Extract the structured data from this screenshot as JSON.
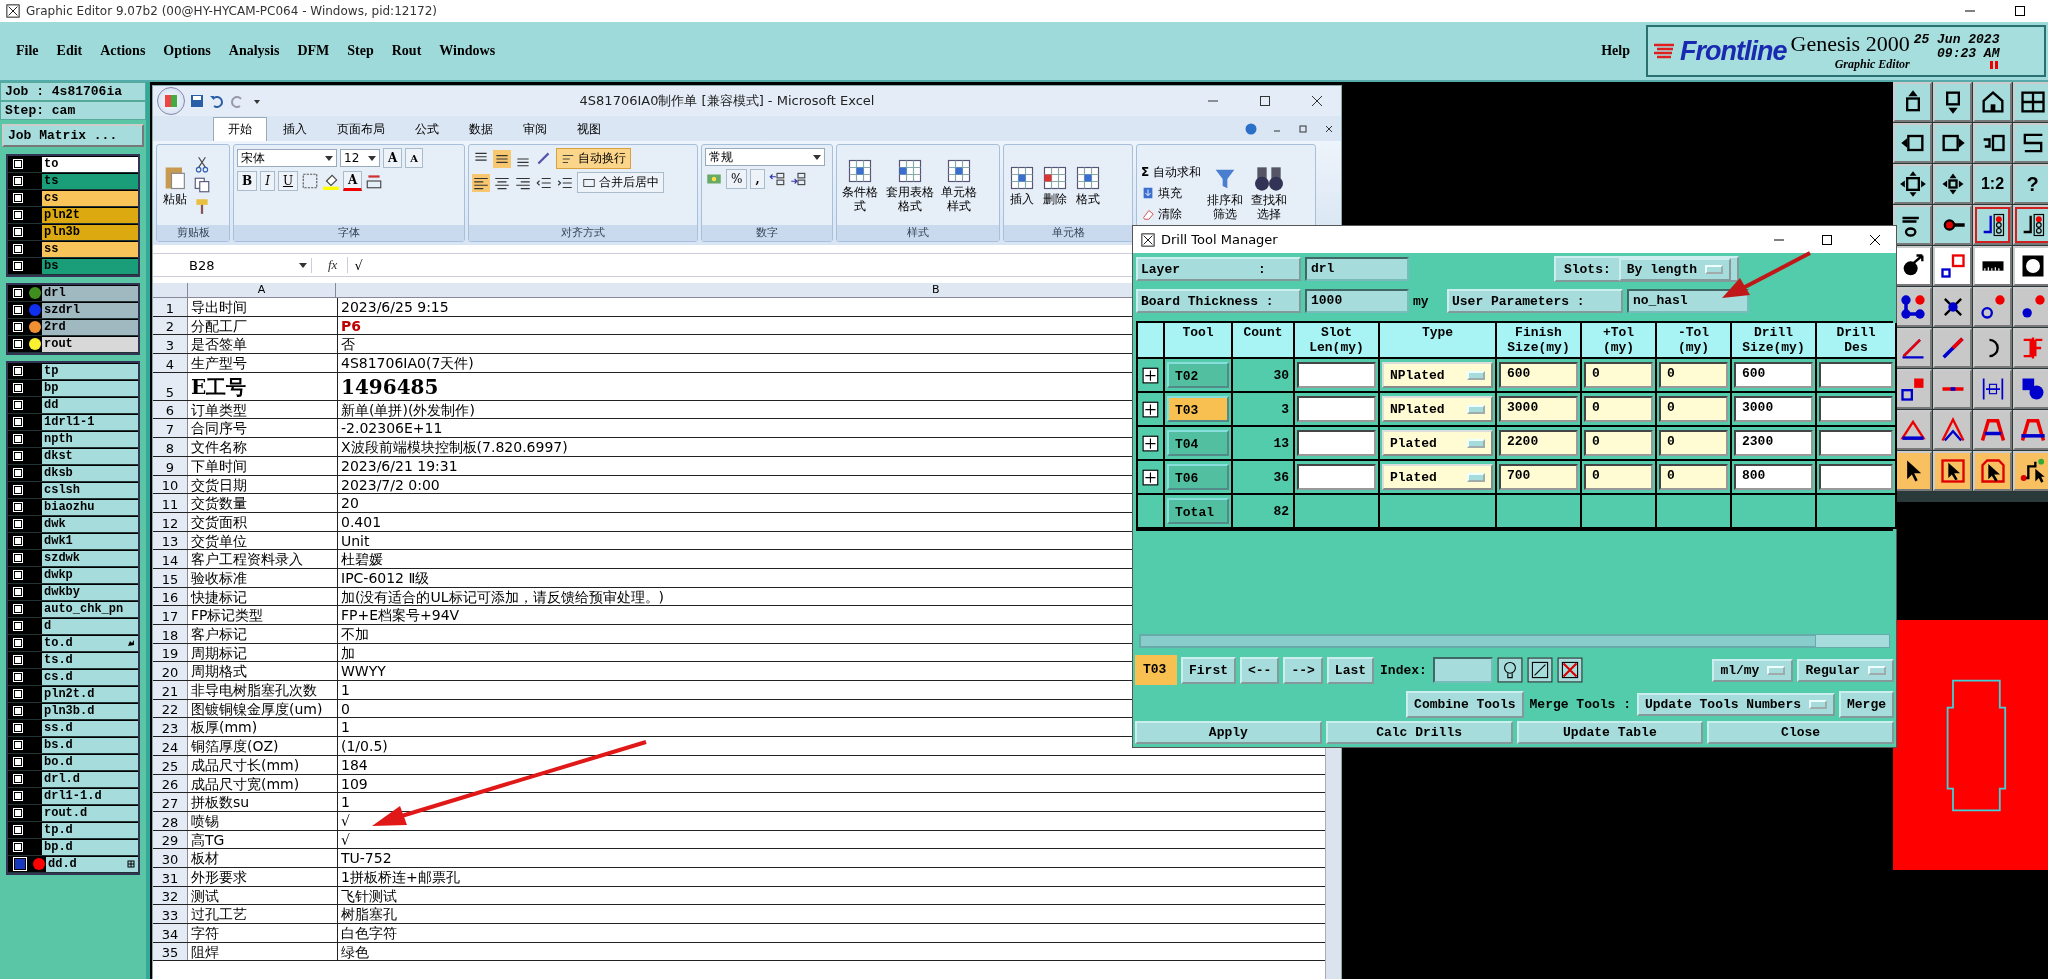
{
  "app_window": {
    "title": "Graphic Editor 9.07b2 (00@HY-HYCAM-PC064 - Windows, pid:12172)"
  },
  "menu": [
    "File",
    "Edit",
    "Actions",
    "Options",
    "Analysis",
    "DFM",
    "Step",
    "Rout",
    "Windows"
  ],
  "help": "Help",
  "brand": {
    "logo": "Frontline",
    "product": "Genesis 2000",
    "subtitle": "Graphic Editor",
    "date": "25 Jun 2023",
    "time": "09:23 AM"
  },
  "job_panel": {
    "job": "Job : 4s81706ia",
    "step": "Step: cam",
    "matrix_button": "Job Matrix ..."
  },
  "layer_groups": [
    {
      "layers": [
        {
          "name": "to",
          "kind": "board",
          "color": "#ffffff",
          "active": false
        },
        {
          "name": "ts",
          "kind": "board",
          "color": "#1a9e7a",
          "active": false
        },
        {
          "name": "cs",
          "kind": "board",
          "color": "#f9c55a",
          "active": false
        },
        {
          "name": "pln2t",
          "kind": "board",
          "color": "#dcaa10",
          "active": false
        },
        {
          "name": "pln3b",
          "kind": "board",
          "color": "#dcaa10",
          "active": false
        },
        {
          "name": "ss",
          "kind": "board",
          "color": "#f9c55a",
          "active": false
        },
        {
          "name": "bs",
          "kind": "board",
          "color": "#1a9e7a",
          "active": false
        }
      ]
    },
    {
      "layers": [
        {
          "name": "drl",
          "kind": "drill",
          "color": "#3f8f1f",
          "active": false
        },
        {
          "name": "szdrl",
          "kind": "drill",
          "color": "#1030f0",
          "active": false
        },
        {
          "name": "2rd",
          "kind": "drill",
          "color": "#f09030",
          "active": false
        },
        {
          "name": "rout",
          "kind": "rout",
          "color": "#f8f030",
          "active": false
        }
      ]
    },
    {
      "layers": [
        {
          "name": "tp",
          "active": false
        },
        {
          "name": "bp",
          "active": false
        },
        {
          "name": "dd",
          "active": false
        },
        {
          "name": "1drl1-1",
          "active": false
        },
        {
          "name": "npth",
          "active": false
        },
        {
          "name": "dkst",
          "active": false
        },
        {
          "name": "dksb",
          "active": false
        },
        {
          "name": "cslsh",
          "active": false
        },
        {
          "name": "biaozhu",
          "active": false
        },
        {
          "name": "dwk",
          "active": false
        },
        {
          "name": "dwk1",
          "active": false
        },
        {
          "name": "szdwk",
          "active": false
        },
        {
          "name": "dwkp",
          "active": false
        },
        {
          "name": "dwkby",
          "active": false
        },
        {
          "name": "auto_chk_pn",
          "active": false
        },
        {
          "name": "d",
          "active": false
        },
        {
          "name": "to.d",
          "kind": "hand",
          "active": false
        },
        {
          "name": "ts.d",
          "active": false
        },
        {
          "name": "cs.d",
          "active": false
        },
        {
          "name": "pln2t.d",
          "active": false
        },
        {
          "name": "pln3b.d",
          "active": false
        },
        {
          "name": "ss.d",
          "active": false
        },
        {
          "name": "bs.d",
          "active": false
        },
        {
          "name": "bo.d",
          "active": false
        },
        {
          "name": "drl.d",
          "active": false
        },
        {
          "name": "drl1-1.d",
          "active": false
        },
        {
          "name": "rout.d",
          "active": false
        },
        {
          "name": "tp.d",
          "active": false
        },
        {
          "name": "bp.d",
          "active": false
        },
        {
          "name": "dd.d",
          "kind": "work",
          "color": "#ff0000",
          "active": true
        }
      ]
    }
  ],
  "toolbar": {
    "ratio": "1:2",
    "help": "?"
  },
  "excel": {
    "title": "4S81706IA0制作单  [兼容模式] - Microsoft Excel",
    "tabs": [
      {
        "label": "开始",
        "selected": true
      },
      {
        "label": "插入",
        "selected": false
      },
      {
        "label": "页面布局",
        "selected": false
      },
      {
        "label": "公式",
        "selected": false
      },
      {
        "label": "数据",
        "selected": false
      },
      {
        "label": "审阅",
        "selected": false
      },
      {
        "label": "视图",
        "selected": false
      }
    ],
    "ribbon": [
      {
        "kind": "clipboard",
        "label": "剪贴板",
        "paste": "粘贴"
      },
      {
        "kind": "font",
        "label": "字体",
        "font": "宋体",
        "size": "12",
        "grow": "A",
        "shrink": "A",
        "styles": [
          "B",
          "I",
          "U"
        ],
        "font_color": "A"
      },
      {
        "kind": "alignment",
        "label": "对齐方式",
        "vertical": [
          {
            "selected": false
          },
          {
            "selected": true
          },
          {
            "selected": false
          }
        ],
        "horizontal": [
          {
            "selected": true
          },
          {
            "selected": false
          },
          {
            "selected": false
          }
        ],
        "wrap": {
          "label": "自动换行",
          "selected": true
        },
        "merge": "合并后居中"
      },
      {
        "kind": "number",
        "label": "数字",
        "format": "常规",
        "percent": "%",
        "comma": ","
      },
      {
        "kind": "styles",
        "label": "样式",
        "buttons": [
          "条件格式",
          "套用表格格式",
          "单元格样式"
        ]
      },
      {
        "kind": "cells",
        "label": "单元格",
        "buttons": [
          "插入",
          "删除",
          "格式"
        ]
      },
      {
        "kind": "editing",
        "sum_sign": "Σ",
        "items": [
          "自动求和",
          "填充",
          "清除"
        ],
        "buttons": [
          "排序和筛选",
          "查找和选择"
        ]
      }
    ],
    "name_box": "B28",
    "fx": "fx",
    "formula": "√",
    "columns": [
      "A",
      "B"
    ],
    "rows": [
      {
        "n": "1",
        "label": "导出时间",
        "value": "2023/6/25  9:15"
      },
      {
        "n": "2",
        "label": "分配工厂",
        "value": "P6",
        "color": "#c00000"
      },
      {
        "n": "3",
        "label": "是否签单",
        "value": "否"
      },
      {
        "n": "4",
        "label": "生产型号",
        "value": "4S81706IA0(7天件)"
      },
      {
        "n": "5",
        "label": "E工号",
        "value": "1496485",
        "large": true
      },
      {
        "n": "6",
        "label": "订单类型",
        "value": "新单(单拼)(外发制作)"
      },
      {
        "n": "7",
        "label": "合同序号",
        "value": "-2.02306E+11"
      },
      {
        "n": "8",
        "label": "文件名称",
        "value": "X波段前端模块控制板(7.820.6997)"
      },
      {
        "n": "9",
        "label": "下单时间",
        "value": "2023/6/21 19:31"
      },
      {
        "n": "10",
        "label": "交货日期",
        "value": "2023/7/2 0:00"
      },
      {
        "n": "11",
        "label": "交货数量",
        "value": "20"
      },
      {
        "n": "12",
        "label": "交货面积",
        "value": "0.401"
      },
      {
        "n": "13",
        "label": "交货单位",
        "value": "Unit"
      },
      {
        "n": "14",
        "label": "客户工程资料录入",
        "value": "杜碧媛"
      },
      {
        "n": "15",
        "label": "验收标准",
        "value": "IPC-6012 Ⅱ级"
      },
      {
        "n": "16",
        "label": "快捷标记",
        "value": "加(没有适合的UL标记可添加，请反馈给预审处理。)"
      },
      {
        "n": "17",
        "label": "FP标记类型",
        "value": "FP+E档案号+94V"
      },
      {
        "n": "18",
        "label": "客户标记",
        "value": "不加"
      },
      {
        "n": "19",
        "label": "周期标记",
        "value": "加"
      },
      {
        "n": "20",
        "label": "周期格式",
        "value": "WWYY"
      },
      {
        "n": "21",
        "label": "非导电树脂塞孔次数",
        "value": "1"
      },
      {
        "n": "22",
        "label": "图镀铜镍金厚度(um)",
        "value": "0"
      },
      {
        "n": "23",
        "label": "板厚(mm)",
        "value": "1"
      },
      {
        "n": "24",
        "label": "铜箔厚度(OZ)",
        "value": " (1/0.5)"
      },
      {
        "n": "25",
        "label": "成品尺寸长(mm)",
        "value": "184"
      },
      {
        "n": "26",
        "label": "成品尺寸宽(mm)",
        "value": "109"
      },
      {
        "n": "27",
        "label": "拼板数su",
        "value": "1"
      },
      {
        "n": "28",
        "label": "喷锡",
        "value": "√"
      },
      {
        "n": "29",
        "label": "高TG",
        "value": "√"
      },
      {
        "n": "30",
        "label": "板材",
        "value": "TU-752"
      },
      {
        "n": "31",
        "label": "外形要求",
        "value": "1拼板桥连+邮票孔"
      },
      {
        "n": "32",
        "label": "测试",
        "value": "飞针测试"
      },
      {
        "n": "33",
        "label": "过孔工艺",
        "value": "树脂塞孔"
      },
      {
        "n": "34",
        "label": "字符",
        "value": "白色字符"
      },
      {
        "n": "35",
        "label": "阻焊",
        "value": "绿色"
      }
    ]
  },
  "drill_manager": {
    "title": "Drill Tool Manager",
    "layer_label": "Layer          :",
    "layer": "drl",
    "slots_label": "Slots:",
    "slots": "By length",
    "thickness_label": "Board Thickness :",
    "thickness": "1000",
    "unit": "my",
    "params_label": "User Parameters :",
    "params": "no_hasl",
    "columns": [
      "Tool",
      "Count",
      "Slot\nLen(my)",
      "Type",
      "Finish\nSize(my)",
      "+Tol\n(my)",
      "-Tol\n(my)",
      "Drill\nSize(my)",
      "Drill\nDes"
    ],
    "tools": [
      {
        "tool": "T02",
        "selected": false,
        "count": "30",
        "type": "NPlated",
        "finish": "600",
        "plus_tol": "0",
        "minus_tol": "0",
        "drill_size": "600"
      },
      {
        "tool": "T03",
        "selected": true,
        "count": "3",
        "type": "NPlated",
        "finish": "3000",
        "plus_tol": "0",
        "minus_tol": "0",
        "drill_size": "3000"
      },
      {
        "tool": "T04",
        "selected": false,
        "count": "13",
        "type": "Plated",
        "finish": "2200",
        "plus_tol": "0",
        "minus_tol": "0",
        "drill_size": "2300"
      },
      {
        "tool": "T06",
        "selected": false,
        "count": "36",
        "type": "Plated",
        "finish": "700",
        "plus_tol": "0",
        "minus_tol": "0",
        "drill_size": "800"
      }
    ],
    "total": {
      "label": "Total",
      "count": "82"
    },
    "current": "T03",
    "nav": [
      "First",
      "<--",
      "-->",
      "Last"
    ],
    "index_label": "Index:",
    "units": "ml/my",
    "mode": "Regular",
    "combine": "Combine Tools",
    "merge_label": "Merge Tools :",
    "merge_mode": "Update Tools Numbers",
    "merge": "Merge",
    "actions": [
      "Apply",
      "Calc Drills",
      "Update Table",
      "Close"
    ]
  }
}
